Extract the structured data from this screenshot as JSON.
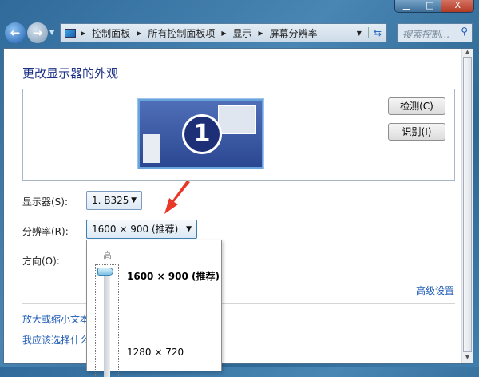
{
  "window": {
    "minimize": "▁",
    "maximize": "□",
    "close": "X"
  },
  "address": {
    "crumbs": [
      "控制面板",
      "所有控制面板项",
      "显示",
      "屏幕分辨率"
    ]
  },
  "search": {
    "placeholder": "搜索控制..."
  },
  "page": {
    "title": "更改显示器的外观",
    "monitor_number": "1",
    "detect_button": "检测(C)",
    "identify_button": "识别(I)",
    "display_label": "显示器(S):",
    "display_value": "1. B325",
    "resolution_label": "分辨率(R):",
    "resolution_value": "1600 × 900 (推荐)",
    "orientation_label": "方向(O):",
    "advanced_link": "高级设置",
    "link_text_size": "放大或缩小文本",
    "link_which_settings": "我应该选择什么"
  },
  "dropdown": {
    "high_label": "高",
    "options": [
      "1600 × 900 (推荐)",
      "1280 × 720"
    ],
    "selected_index": 0
  },
  "colors": {
    "accent": "#1e5bb5",
    "title": "#1e3287",
    "arrow": "#e8382a"
  }
}
